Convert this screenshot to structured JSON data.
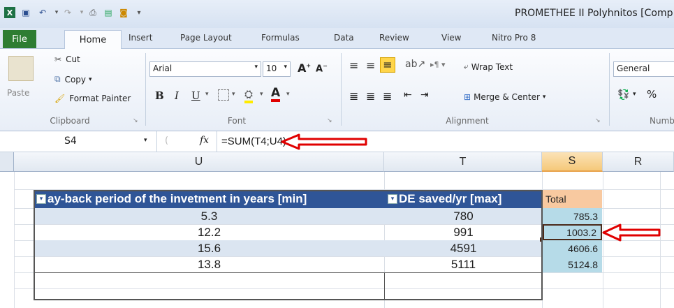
{
  "window": {
    "title": "PROMETHEE II Polyhnitos  [Comp"
  },
  "tabs": [
    "File",
    "Home",
    "Insert",
    "Page Layout",
    "Formulas",
    "Data",
    "Review",
    "View",
    "Nitro Pro 8"
  ],
  "clipboard": {
    "paste": "Paste",
    "cut": "Cut",
    "copy": "Copy",
    "format_painter": "Format Painter",
    "label": "Clipboard"
  },
  "font": {
    "name": "Arial",
    "size": "10",
    "bold": "B",
    "italic": "I",
    "underline": "U",
    "label": "Font"
  },
  "alignment": {
    "wrap_text": "Wrap Text",
    "merge_center": "Merge & Center",
    "label": "Alignment"
  },
  "number": {
    "format": "General",
    "percent": "%",
    "label": "Numb"
  },
  "formula_bar": {
    "name_box": "S4",
    "fx": "fx",
    "formula": "=SUM(T4;U4)"
  },
  "columns": {
    "U": "U",
    "T": "T",
    "S": "S",
    "R": "R"
  },
  "table": {
    "headers": {
      "U": "ay-back period of the invetment in years [min]",
      "T": "DE saved/yr [max]",
      "S": "Total"
    },
    "rows": [
      {
        "U": "5.3",
        "T": "780",
        "S": "785.3"
      },
      {
        "U": "12.2",
        "T": "991",
        "S": "1003.2"
      },
      {
        "U": "15.6",
        "T": "4591",
        "S": "4606.6"
      },
      {
        "U": "13.8",
        "T": "5111",
        "S": "5124.8"
      }
    ]
  },
  "colors": {
    "file_tab": "#2e7d32",
    "header_blue": "#2f5597",
    "total_orange": "#f8c9a0",
    "band_blue": "#dbe5f1",
    "annotation_red": "#e00000"
  }
}
